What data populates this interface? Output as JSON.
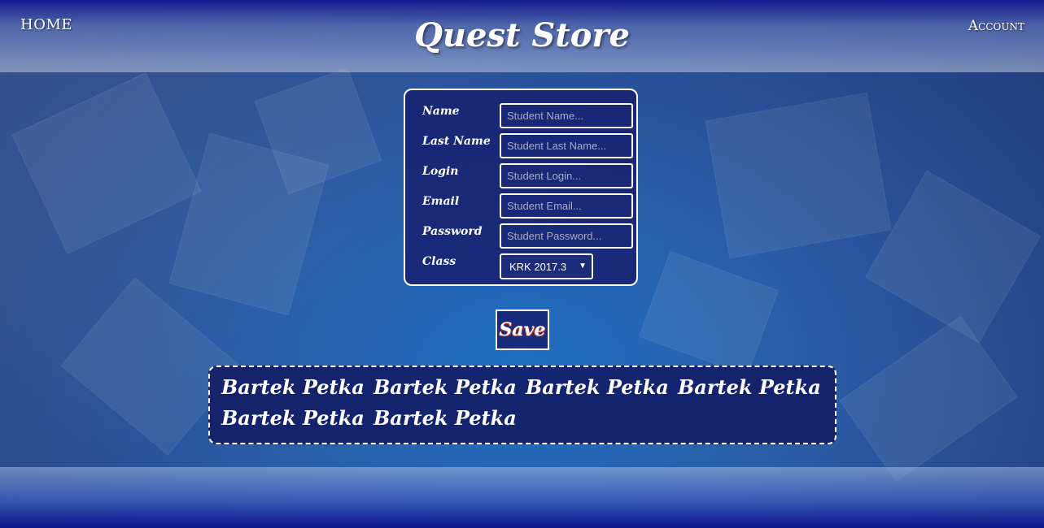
{
  "nav": {
    "home_label": "HOME",
    "account_label": "Account"
  },
  "header": {
    "title": "Quest Store"
  },
  "form": {
    "fields": [
      {
        "label": "Name",
        "placeholder": "Student Name..."
      },
      {
        "label": "Last Name",
        "placeholder": "Student Last Name..."
      },
      {
        "label": "Login",
        "placeholder": "Student Login..."
      },
      {
        "label": "Email",
        "placeholder": "Student Email..."
      },
      {
        "label": "Password",
        "placeholder": "Student Password..."
      }
    ],
    "class_label": "Class",
    "class_selected": "KRK 2017.3",
    "class_arrow_icon": "▼",
    "save_label": "Save"
  },
  "students": [
    "Bartek Petka",
    "Bartek Petka",
    "Bartek Petka",
    "Bartek Petka",
    "Bartek Petka",
    "Bartek Petka"
  ]
}
